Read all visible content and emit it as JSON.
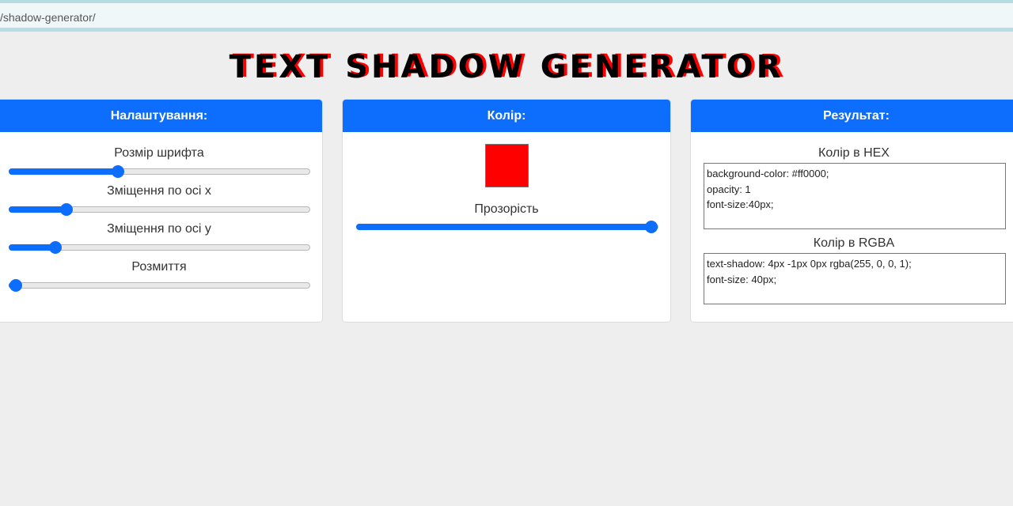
{
  "browser": {
    "url": "/shadow-generator/"
  },
  "page": {
    "title": "TEXT SHADOW GENERATOR"
  },
  "settings_card": {
    "header": "Налаштування:",
    "sliders": [
      {
        "label": "Розмір шрифта",
        "value_fraction": 0.355
      },
      {
        "label": "Зміщення по осі х",
        "value_fraction": 0.175
      },
      {
        "label": "Зміщення по осі у",
        "value_fraction": 0.137
      },
      {
        "label": "Розмиття",
        "value_fraction": 0.0
      }
    ]
  },
  "color_card": {
    "header": "Колір:",
    "swatch_color": "#ff0000",
    "opacity_label": "Прозорість",
    "opacity_fraction": 1.0
  },
  "result_card": {
    "header": "Результат:",
    "hex_label": "Колір в HEX",
    "hex_output": "background-color: #ff0000;\nopacity: 1\nfont-size:40px;",
    "rgba_label": "Колір в RGBA",
    "rgba_output": "text-shadow: 4px -1px 0px rgba(255, 0, 0, 1);\nfont-size: 40px;"
  },
  "colors": {
    "accent": "#0d6efd",
    "shadow": "#ff0000"
  }
}
